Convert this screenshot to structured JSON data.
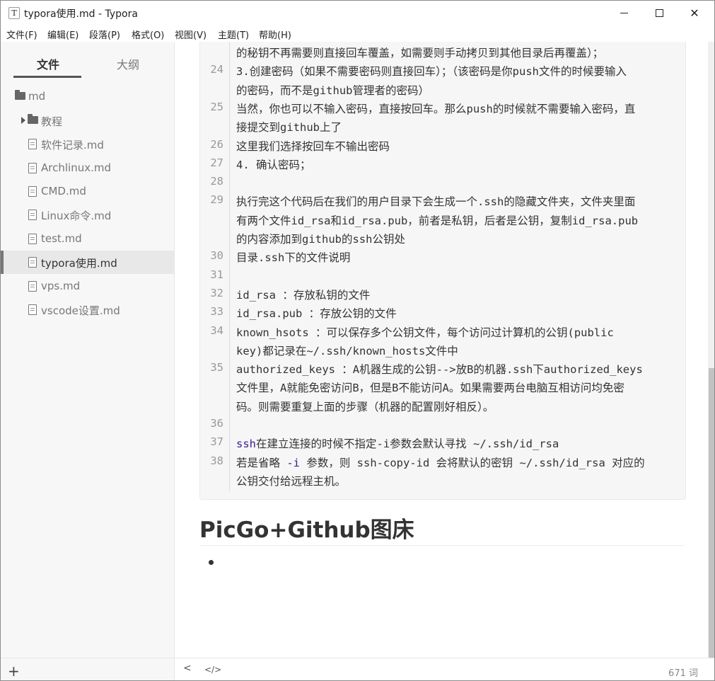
{
  "window": {
    "title": "typora使用.md - Typora",
    "app_icon": "T",
    "minimize_icon": "minimize-icon",
    "maximize_icon": "maximize-icon",
    "close_icon": "close-icon",
    "close_glyph": "✕"
  },
  "menu": [
    "文件(F)",
    "编辑(E)",
    "段落(P)",
    "格式(O)",
    "视图(V)",
    "主题(T)",
    "帮助(H)"
  ],
  "sidebar": {
    "tabs": {
      "files": "文件",
      "outline": "大纲"
    },
    "tree": [
      {
        "label": "md",
        "type": "folder-root"
      },
      {
        "label": "教程",
        "type": "folder"
      },
      {
        "label": "软件记录.md",
        "type": "file"
      },
      {
        "label": "Archlinux.md",
        "type": "file"
      },
      {
        "label": "CMD.md",
        "type": "file"
      },
      {
        "label": "Linux命令.md",
        "type": "file"
      },
      {
        "label": "test.md",
        "type": "file"
      },
      {
        "label": "typora使用.md",
        "type": "file",
        "active": true
      },
      {
        "label": "vps.md",
        "type": "file"
      },
      {
        "label": "vscode设置.md",
        "type": "file"
      }
    ],
    "footer": {
      "add_glyph": "+"
    }
  },
  "editor": {
    "code_lines": [
      {
        "n": "",
        "t": "的秘钥不再需要则直接回车覆盖，如需要则手动拷贝到其他目录后再覆盖）；"
      },
      {
        "n": "24",
        "t": "3.创建密码（如果不需要密码则直接回车）；（该密码是你push文件的时候要输入"
      },
      {
        "n": "",
        "t": "的密码，而不是github管理者的密码）"
      },
      {
        "n": "25",
        "t": "当然，你也可以不输入密码，直接按回车。那么push的时候就不需要输入密码，直"
      },
      {
        "n": "",
        "t": "接提交到github上了"
      },
      {
        "n": "26",
        "t": "这里我们选择按回车不输出密码"
      },
      {
        "n": "27",
        "t": "4. 确认密码；"
      },
      {
        "n": "28",
        "t": ""
      },
      {
        "n": "29",
        "t": "执行完这个代码后在我们的用户目录下会生成一个.ssh的隐藏文件夹，文件夹里面"
      },
      {
        "n": "",
        "t": "有两个文件id_rsa和id_rsa.pub，前者是私钥，后者是公钥，复制id_rsa.pub"
      },
      {
        "n": "",
        "t": "的内容添加到github的ssh公钥处"
      },
      {
        "n": "30",
        "t": "目录.ssh下的文件说明"
      },
      {
        "n": "31",
        "t": ""
      },
      {
        "n": "32",
        "t": "id_rsa ：存放私钥的文件"
      },
      {
        "n": "33",
        "t": "id_rsa.pub ：存放公钥的文件"
      },
      {
        "n": "34",
        "t": "known_hsots ：可以保存多个公钥文件，每个访问过计算机的公钥(public"
      },
      {
        "n": "",
        "t": "key)都记录在~/.ssh/known_hosts文件中"
      },
      {
        "n": "35",
        "t": "authorized_keys ：A机器生成的公钥-->放B的机器.ssh下authorized_keys"
      },
      {
        "n": "",
        "t": "文件里，A就能免密访问B，但是B不能访问A。如果需要两台电脑互相访问均免密"
      },
      {
        "n": "",
        "t": "码。则需要重复上面的步骤（机器的配置刚好相反）。"
      },
      {
        "n": "36",
        "t": ""
      },
      {
        "n": "37",
        "t": "ssh在建立连接的时候不指定-i参数会默认寻找 ~/.ssh/id_rsa",
        "kw": "ssh",
        "rest": "在建立连接的时候不指定-i参数会默认寻找 ~/.ssh/id_rsa"
      },
      {
        "n": "38",
        "t": "若是省略 -i 参数，则 ssh-copy-id 会将默认的密钥 ~/.ssh/id_rsa 对应的",
        "pre": "若是省略 ",
        "kw": "-i",
        "rest": " 参数，则 ssh-copy-id 会将默认的密钥 ~/.ssh/id_rsa 对应的"
      },
      {
        "n": "",
        "t": "公钥交付给远程主机。"
      }
    ],
    "heading": "PicGo+Github图床"
  },
  "statusbar": {
    "back_glyph": "<",
    "source_glyph": "</>",
    "word_count": "671 词"
  }
}
